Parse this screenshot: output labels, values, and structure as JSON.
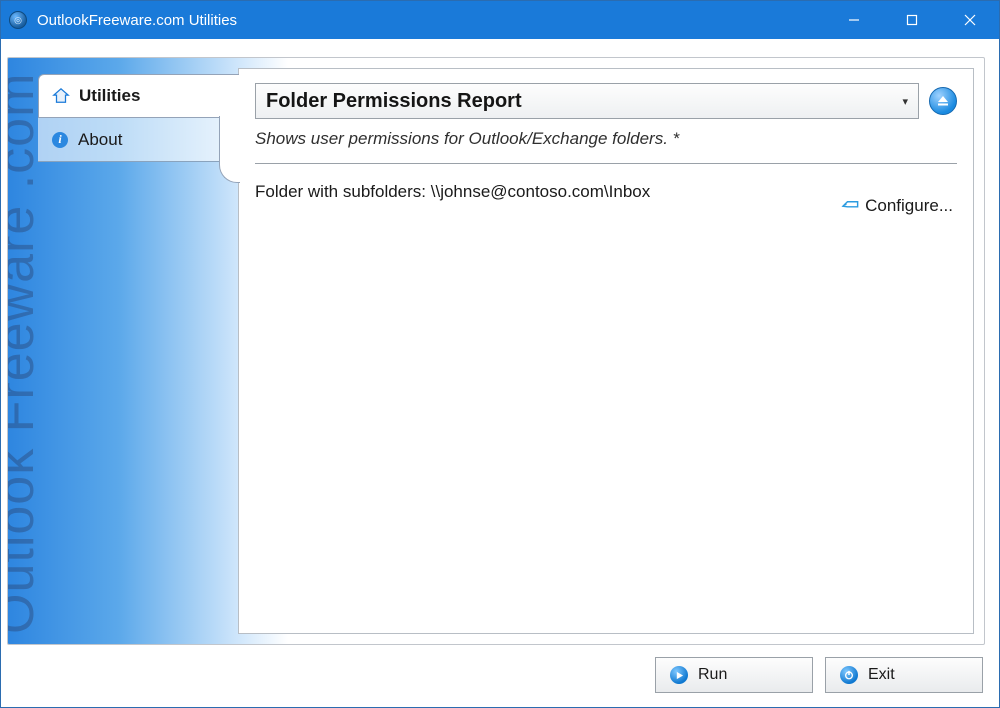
{
  "window": {
    "title": "OutlookFreeware.com Utilities"
  },
  "watermark": "Outlook Freeware .com",
  "sidebar": {
    "tabs": [
      {
        "label": "Utilities",
        "active": true
      },
      {
        "label": "About",
        "active": false
      }
    ]
  },
  "report": {
    "title": "Folder Permissions Report",
    "description": "Shows user permissions for Outlook/Exchange folders. *",
    "folder_label": "Folder with subfolders: \\\\johnse@contoso.com\\Inbox",
    "configure_label": "Configure..."
  },
  "buttons": {
    "run": "Run",
    "exit": "Exit"
  }
}
